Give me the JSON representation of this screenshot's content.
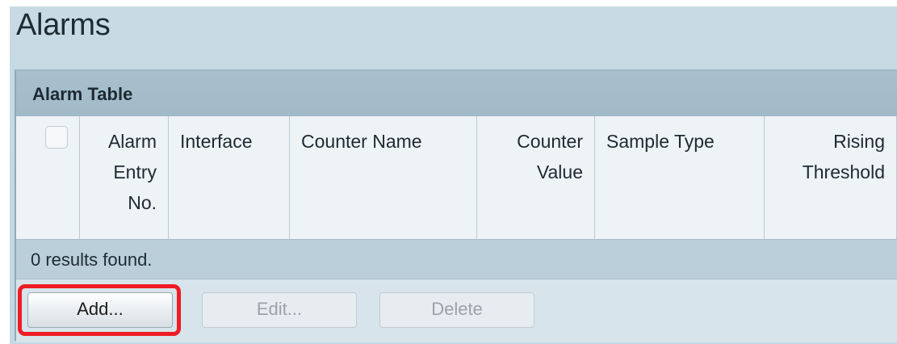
{
  "page": {
    "title": "Alarms"
  },
  "alarm_table": {
    "title": "Alarm Table",
    "columns": {
      "alarm_entry_no": {
        "line1": "Alarm",
        "line2": "Entry",
        "line3": "No."
      },
      "interface": "Interface",
      "counter_name": "Counter Name",
      "counter_value": {
        "line1": "Counter",
        "line2": "Value"
      },
      "sample_type": "Sample Type",
      "rising_threshold": {
        "line1": "Rising",
        "line2": "Threshold"
      }
    },
    "rows": [],
    "results_text": "0 results found."
  },
  "buttons": {
    "add": "Add...",
    "edit": "Edit...",
    "delete": "Delete"
  },
  "colors": {
    "highlight": "#ee1c24",
    "header_bar": "#a8c0cd",
    "disabled_text": "#9aa3a8"
  }
}
